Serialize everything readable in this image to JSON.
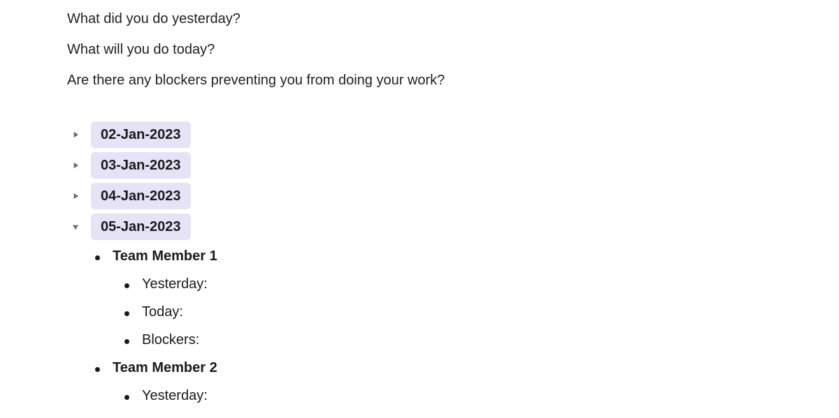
{
  "intro": {
    "line1": "What did you do yesterday?",
    "line2": "What will you do today?",
    "line3": "Are there any blockers preventing you from doing your work?"
  },
  "dates": [
    {
      "label": "02-Jan-2023",
      "expanded": false
    },
    {
      "label": "03-Jan-2023",
      "expanded": false
    },
    {
      "label": "04-Jan-2023",
      "expanded": false
    },
    {
      "label": "05-Jan-2023",
      "expanded": true
    }
  ],
  "members": [
    {
      "name": "Team Member 1",
      "fields": [
        {
          "label": "Yesterday:"
        },
        {
          "label": "Today:"
        },
        {
          "label": "Blockers:"
        }
      ]
    },
    {
      "name": "Team Member 2",
      "fields": [
        {
          "label": "Yesterday:"
        }
      ]
    }
  ]
}
